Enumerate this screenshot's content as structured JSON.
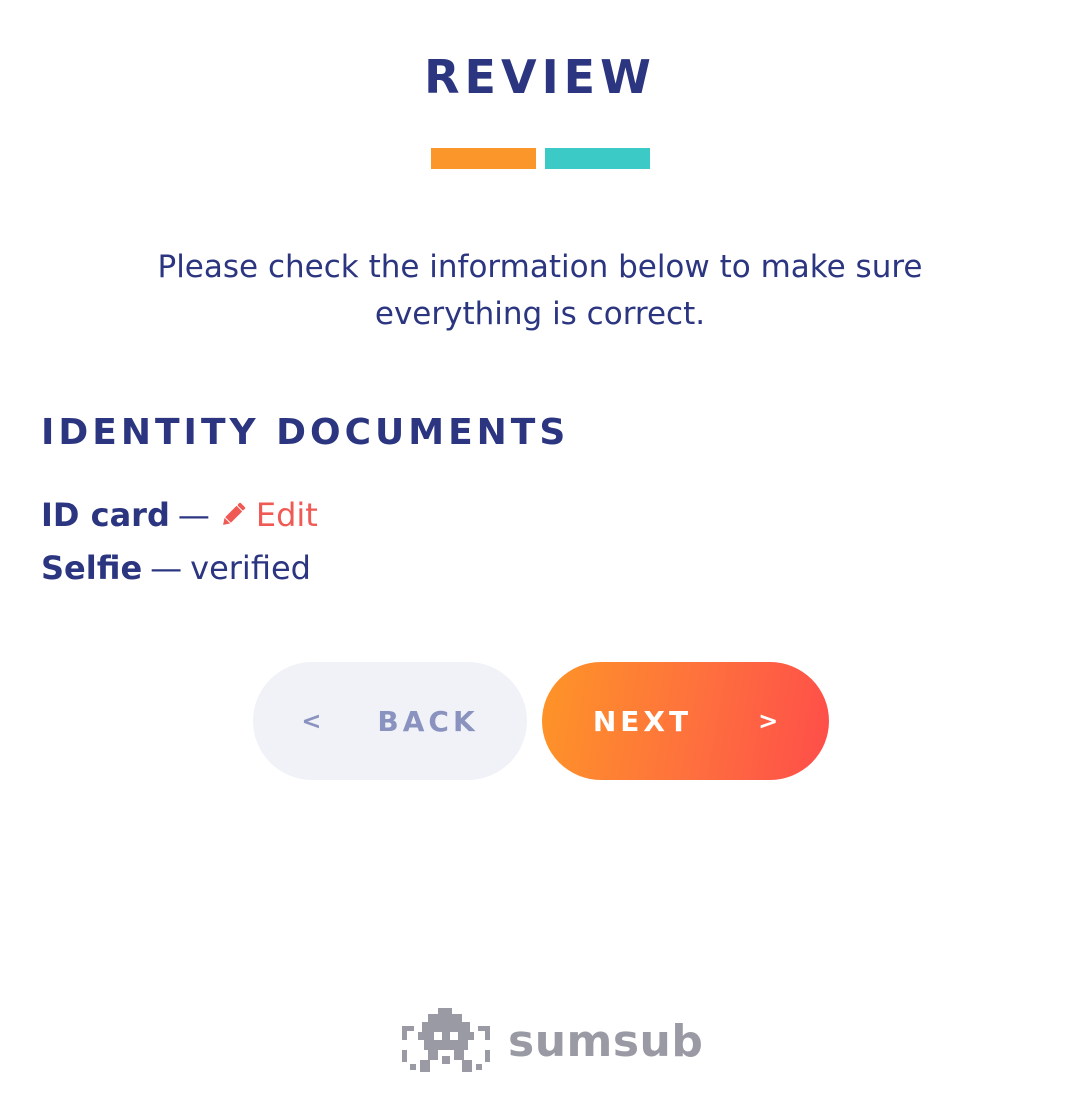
{
  "header": {
    "title": "REVIEW"
  },
  "intro": {
    "text": "Please check the information below to make sure everything is correct."
  },
  "documents_section": {
    "title": "IDENTITY DOCUMENTS",
    "items": [
      {
        "name": "ID card",
        "separator": "—",
        "action_label": "Edit",
        "action_icon": "pencil-icon"
      },
      {
        "name": "Selfie",
        "separator": "—",
        "status": "verified"
      }
    ]
  },
  "navigation": {
    "back_label": "BACK",
    "back_chevron": "<",
    "next_label": "NEXT",
    "next_chevron": ">"
  },
  "brand": {
    "name": "sumsub",
    "logo_icon": "sumsub-logo-icon"
  },
  "colors": {
    "primary_text": "#2b3580",
    "accent_orange": "#fa962a",
    "accent_teal": "#3ccac6",
    "edit_link": "#f05a55",
    "back_button_bg": "#f0f2f7",
    "back_button_text": "#8a93bf",
    "next_gradient_start": "#fe9527",
    "next_gradient_end": "#fe4d4a",
    "brand_gray": "#999aa4"
  }
}
